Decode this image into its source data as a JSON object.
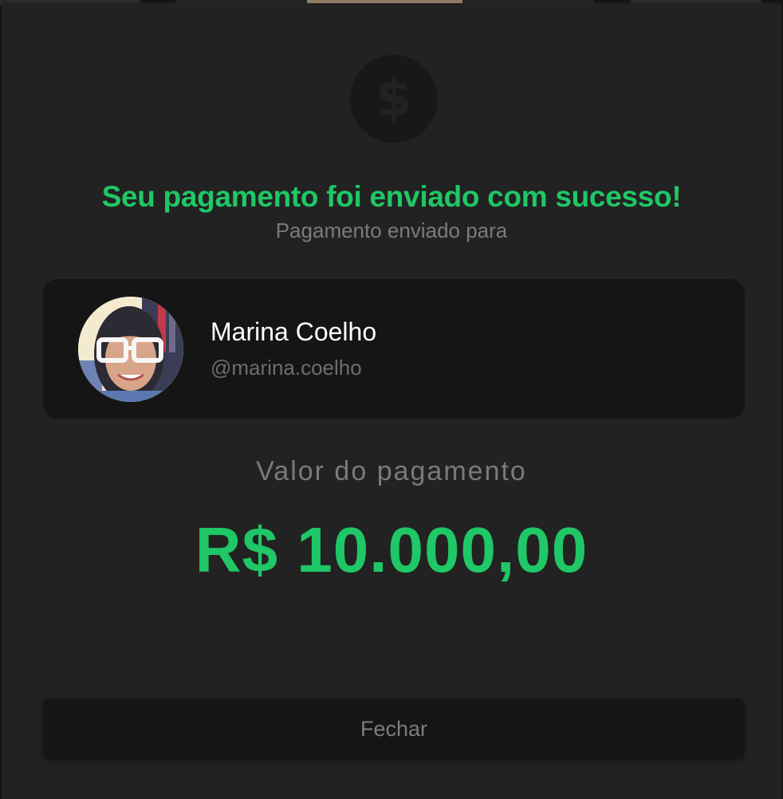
{
  "modal": {
    "icon": "dollar-icon",
    "icon_glyph": "$",
    "title": "Seu pagamento foi enviado com sucesso!",
    "subtitle": "Pagamento enviado para"
  },
  "recipient": {
    "name": "Marina Coelho",
    "handle": "@marina.coelho",
    "avatar": "user-avatar-photo"
  },
  "payment": {
    "label": "Valor do pagamento",
    "amount": "R$ 10.000,00"
  },
  "actions": {
    "close_label": "Fechar"
  },
  "colors": {
    "accent": "#1fc766",
    "modal_bg": "#222222",
    "card_bg": "#151515",
    "muted_text": "#7b7b7b"
  }
}
